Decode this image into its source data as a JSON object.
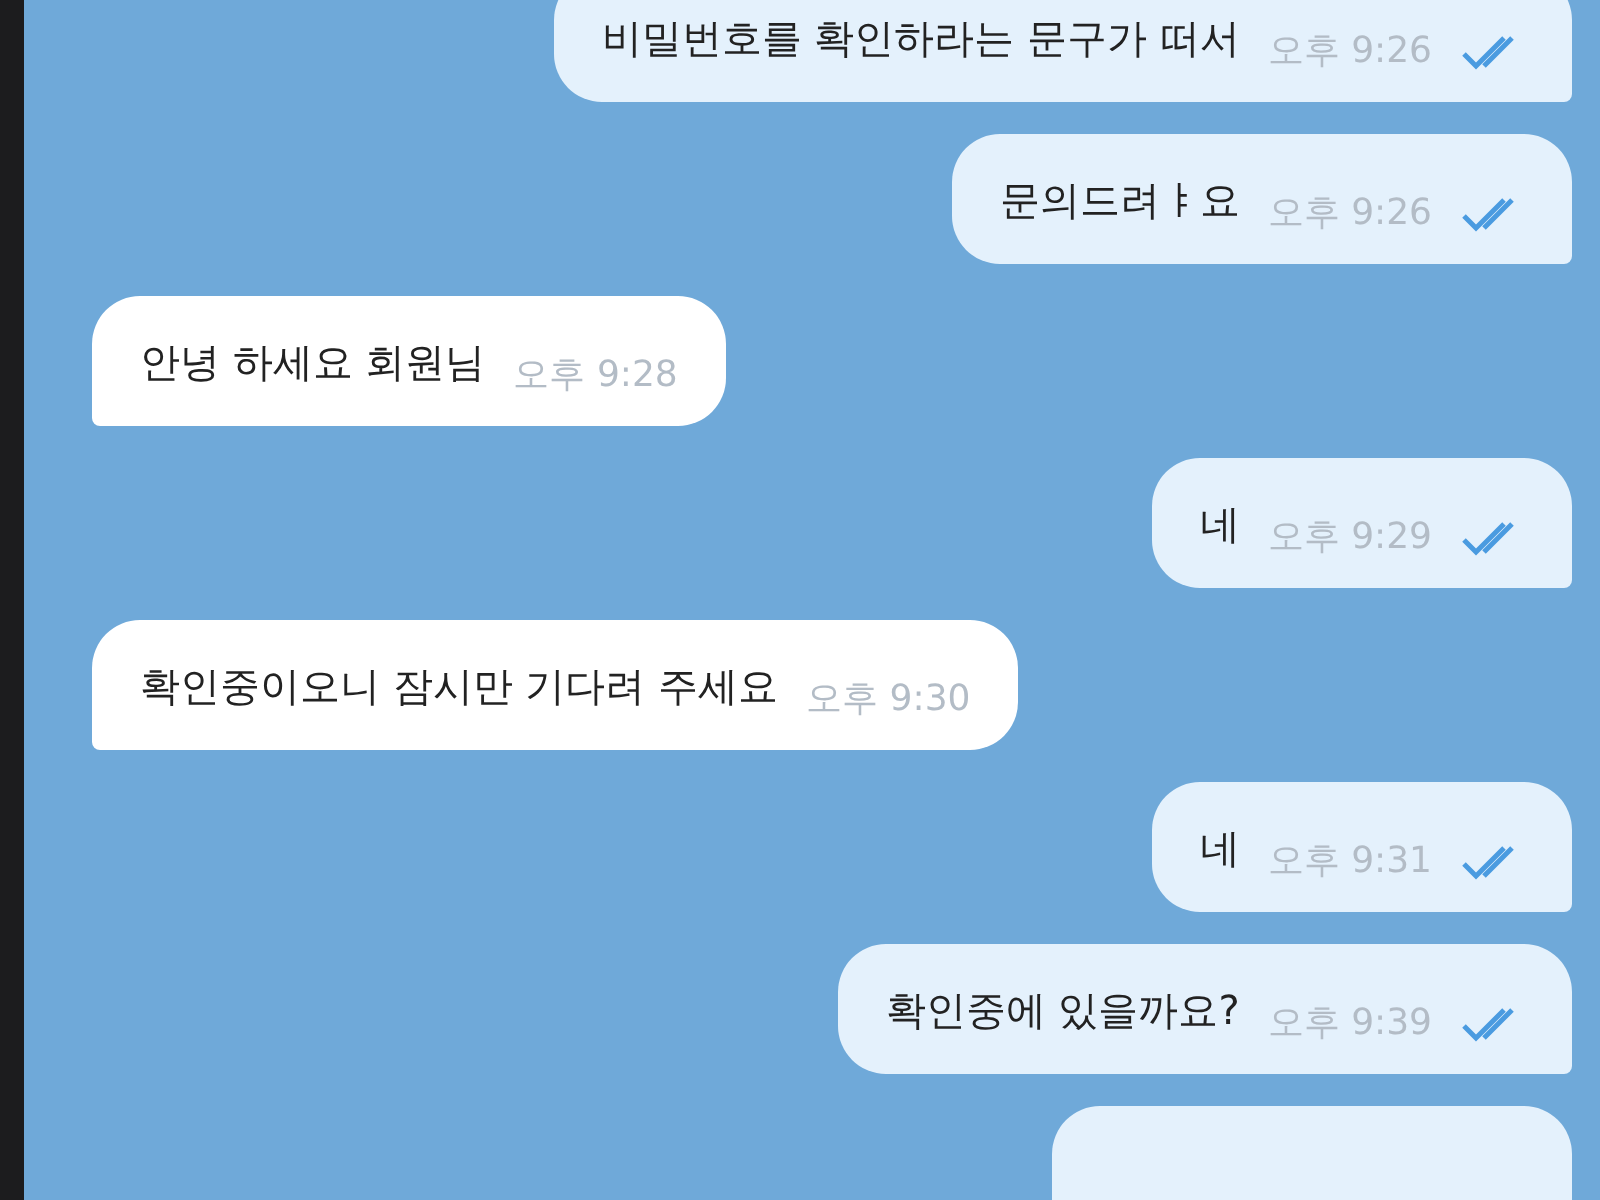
{
  "messages": [
    {
      "kind": "out",
      "text": "비밀번호를 확인하라는 문구가 떠서",
      "time": "오후 9:26",
      "read": true
    },
    {
      "kind": "out",
      "text": "문의드려ㅑ요",
      "time": "오후 9:26",
      "read": true
    },
    {
      "kind": "in",
      "text": "안녕 하세요 회원님",
      "time": "오후 9:28"
    },
    {
      "kind": "out",
      "text": "네",
      "time": "오후 9:29",
      "read": true
    },
    {
      "kind": "in",
      "text": "확인중이오니 잠시만 기다려 주세요",
      "time": "오후 9:30"
    },
    {
      "kind": "out",
      "text": "네",
      "time": "오후 9:31",
      "read": true
    },
    {
      "kind": "out",
      "text": "확인중에 있을까요?",
      "time": "오후 9:39",
      "read": true
    },
    {
      "kind": "out"
    }
  ]
}
